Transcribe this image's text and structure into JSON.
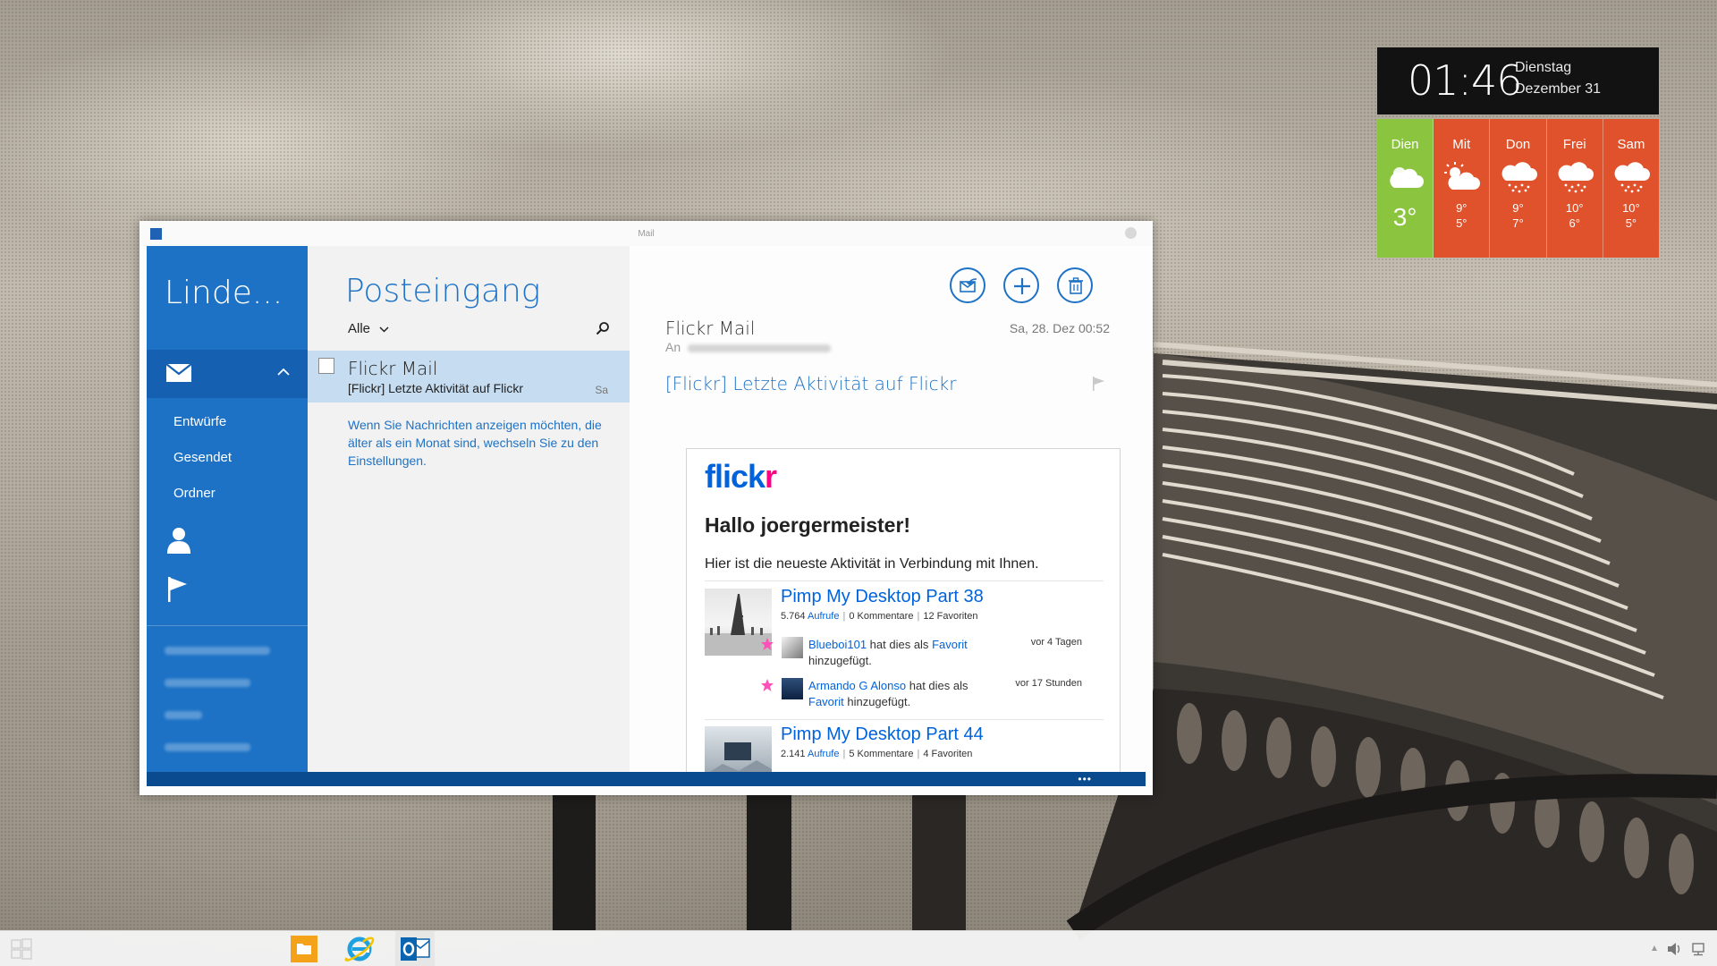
{
  "desktop": {
    "clock": {
      "time": "01:46",
      "weekday": "Dienstag",
      "date": "Dezember 31"
    },
    "weather": [
      {
        "day": "Dien",
        "temp": "3°",
        "icon": "partly-cloudy-icon",
        "today": true,
        "color": "#8bc53f"
      },
      {
        "day": "Mit",
        "hi": "9°",
        "lo": "5°",
        "icon": "partly-sunny-icon",
        "color": "#e0522b"
      },
      {
        "day": "Don",
        "hi": "9°",
        "lo": "7°",
        "icon": "rain-icon",
        "color": "#e0522b"
      },
      {
        "day": "Frei",
        "hi": "10°",
        "lo": "6°",
        "icon": "rain-icon",
        "color": "#e0522b"
      },
      {
        "day": "Sam",
        "hi": "10°",
        "lo": "5°",
        "icon": "rain-icon",
        "color": "#e0522b"
      }
    ]
  },
  "window": {
    "title": "Mail"
  },
  "sidebar": {
    "account": "Linde...",
    "folders": [
      "Entwürfe",
      "Gesendet",
      "Ordner"
    ]
  },
  "list": {
    "heading": "Posteingang",
    "filter": "Alle",
    "item": {
      "sender": "Flickr Mail",
      "subject": "[Flickr] Letzte Aktivität auf Flickr",
      "date": "Sa"
    },
    "note": "Wenn Sie Nachrichten anzeigen möchten, die älter als ein Monat sind, wechseln Sie zu den Einstellungen."
  },
  "reading": {
    "from": "Flickr Mail",
    "to_label": "An",
    "datetime": "Sa, 28. Dez   00:52",
    "subject": "[Flickr] Letzte Aktivität auf Flickr",
    "body": {
      "logo_a": "flick",
      "logo_b": "r",
      "greeting": "Hallo joergermeister!",
      "intro": "Hier ist die neueste Aktivität in Verbindung mit Ihnen.",
      "photos": [
        {
          "title": "Pimp My Desktop Part 38",
          "views": "5.764",
          "views_label": "Aufrufe",
          "comments": "0 Kommentare",
          "favs": "12 Favoriten",
          "activities": [
            {
              "user": "Blueboi101",
              "text": " hat dies als ",
              "link": "Favorit",
              "rest": " hinzugefügt.",
              "when": "vor 4 Tagen"
            },
            {
              "user": "Armando G Alonso",
              "text": " hat dies als ",
              "link": "Favorit",
              "rest": " hinzugefügt.",
              "when": "vor 17 Stunden"
            }
          ]
        },
        {
          "title": "Pimp My Desktop Part 44",
          "views": "2.141",
          "views_label": "Aufrufe",
          "comments": "5 Kommentare",
          "favs": "4 Favoriten"
        }
      ]
    }
  },
  "appbar": {
    "more": "•••"
  },
  "colors": {
    "accent": "#1d72c6",
    "flickr_blue": "#0063dc",
    "flickr_pink": "#ff0084"
  }
}
